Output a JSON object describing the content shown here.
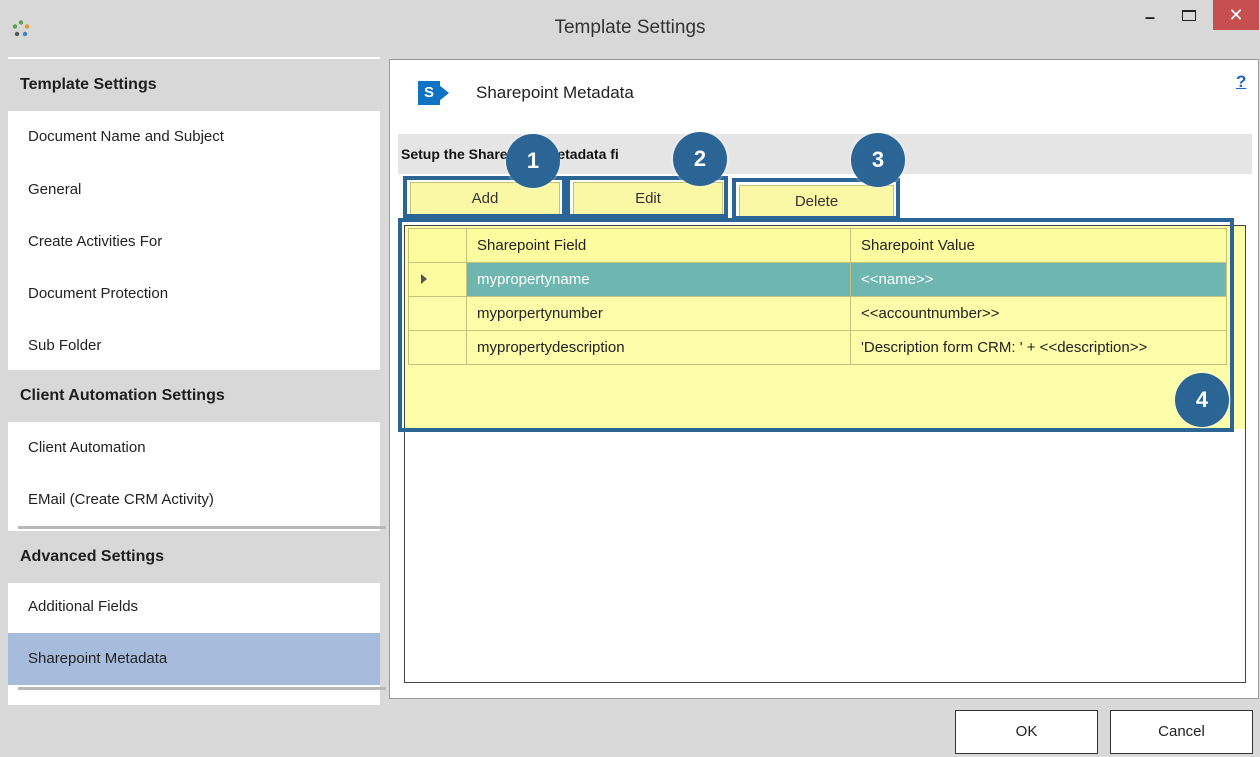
{
  "window": {
    "title": "Template Settings",
    "minimize_glyph": "–",
    "close_glyph": "✕",
    "app_icon": "crm-logo-icon"
  },
  "sidebar": {
    "sections": [
      {
        "header": "Template Settings",
        "items": [
          {
            "label": "Document Name and Subject"
          },
          {
            "label": "General"
          },
          {
            "label": "Create Activities For"
          },
          {
            "label": "Document Protection"
          },
          {
            "label": "Sub Folder"
          }
        ]
      },
      {
        "header": "Client Automation Settings",
        "items": [
          {
            "label": "Client Automation"
          },
          {
            "label": "EMail (Create CRM Activity)"
          }
        ]
      },
      {
        "header": "Advanced Settings",
        "items": [
          {
            "label": "Additional Fields"
          },
          {
            "label": "Sharepoint Metadata",
            "selected": true
          }
        ]
      }
    ]
  },
  "panel": {
    "icon": "sharepoint-icon",
    "title": "Sharepoint Metadata",
    "help": "?",
    "setup_label": "Setup the Sharepoint Metadata fi",
    "buttons": {
      "add": "Add",
      "edit": "Edit",
      "delete": "Delete"
    },
    "grid": {
      "columns": [
        "Sharepoint Field",
        "Sharepoint Value"
      ],
      "rows": [
        {
          "field": "mypropertyname",
          "value": "<<name>>",
          "selected": true
        },
        {
          "field": "myporpertynumber",
          "value": "<<accountnumber>>"
        },
        {
          "field": "mypropertydescription",
          "value": "'Description form CRM: ' + <<description>>"
        }
      ]
    }
  },
  "callouts": [
    "1",
    "2",
    "3",
    "4"
  ],
  "footer": {
    "ok": "OK",
    "cancel": "Cancel"
  },
  "colors": {
    "accent": "#2a6596",
    "selected_nav": "#a7bcdd",
    "grid_bg": "#fdfca9",
    "selected_row": "#6fb6b1",
    "close_button": "#c74f50",
    "sharepoint_blue": "#0f72c4"
  }
}
